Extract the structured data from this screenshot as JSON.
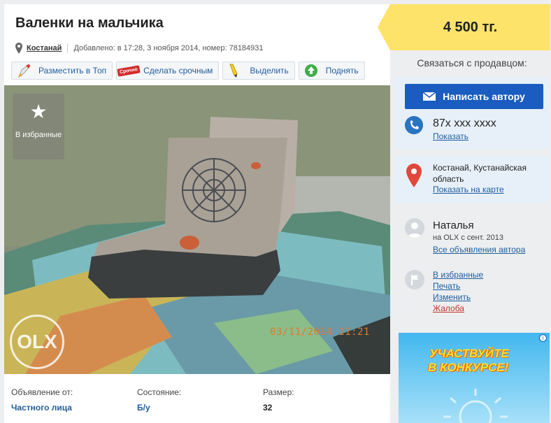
{
  "listing": {
    "title": "Валенки на мальчика",
    "city": "Костанай",
    "added": "Добавлено: в 17:28, 3 ноября 2014, номер: 78184931",
    "price": "4 500 тг."
  },
  "actions": [
    {
      "label": "Разместить в Топ",
      "icon": "rocket-icon"
    },
    {
      "label": "Сделать срочным",
      "icon": "urgent-icon",
      "badge": "Срочно"
    },
    {
      "label": "Выделить",
      "icon": "highlight-pen-icon"
    },
    {
      "label": "Поднять",
      "icon": "up-arrow-icon"
    }
  ],
  "photo": {
    "fav_label": "В избранные",
    "timestamp": "03/11/2014 11:21",
    "watermark": "OLX"
  },
  "details": [
    {
      "label": "Объявление от:",
      "value": "Частного лица"
    },
    {
      "label": "Состояние:",
      "value": "Б/у"
    },
    {
      "label": "Размер:",
      "value": "32"
    }
  ],
  "contact": {
    "heading": "Связаться с продавцом:",
    "write_button": "Написать автору",
    "phone": "87x xxx xxxx",
    "show_phone": "Показать",
    "location": "Костанай, Кустанайская область",
    "show_on_map": "Показать на карте"
  },
  "seller": {
    "name": "Наталья",
    "since": "на OLX с сент. 2013",
    "all_ads": "Все объявления автора"
  },
  "tools": {
    "favorite": "В избранные",
    "print": "Печать",
    "edit": "Изменить",
    "complaint": "Жалоба"
  },
  "banner": {
    "line1": "УЧАСТВУЙТЕ",
    "line2": "В КОНКУРСЕ!",
    "info": "i"
  },
  "colors": {
    "accent_blue": "#1a5cc0",
    "link_blue": "#1f5d9e",
    "price_yellow": "#fde36a",
    "panel_blue": "#e7f0f8",
    "complaint_red": "#c0392b"
  }
}
